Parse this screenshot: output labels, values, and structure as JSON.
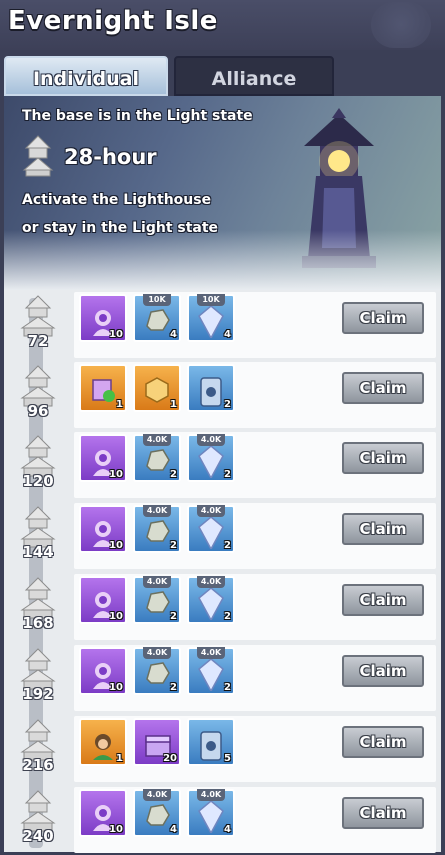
{
  "header": {
    "title": "Evernight Isle"
  },
  "tabs": [
    {
      "label": "Individual",
      "active": true
    },
    {
      "label": "Alliance",
      "active": false
    }
  ],
  "banner": {
    "state_text": "The base is in the Light state",
    "hours": "28-hour",
    "hint_line1": "Activate the Lighthouse",
    "hint_line2": "or stay in the Light state"
  },
  "rewards": [
    {
      "tier": "72",
      "claim_label": "Claim",
      "items": [
        {
          "icon": "hero-shard-icon",
          "color": "purple",
          "tag": "",
          "qty": "10"
        },
        {
          "icon": "stone-icon",
          "color": "blue",
          "tag": "10K",
          "qty": "4"
        },
        {
          "icon": "crystal-icon",
          "color": "blue",
          "tag": "10K",
          "qty": "4"
        }
      ]
    },
    {
      "tier": "96",
      "claim_label": "Claim",
      "items": [
        {
          "icon": "book-icon",
          "color": "orange",
          "tag": "",
          "qty": "1"
        },
        {
          "icon": "badge-icon",
          "color": "orange",
          "tag": "",
          "qty": "1"
        },
        {
          "icon": "card-icon",
          "color": "blue",
          "tag": "",
          "qty": "2"
        }
      ]
    },
    {
      "tier": "120",
      "claim_label": "Claim",
      "items": [
        {
          "icon": "hero-shard-icon",
          "color": "purple",
          "tag": "",
          "qty": "10"
        },
        {
          "icon": "stone-icon",
          "color": "blue",
          "tag": "4.0K",
          "qty": "2"
        },
        {
          "icon": "crystal-icon",
          "color": "blue",
          "tag": "4.0K",
          "qty": "2"
        }
      ]
    },
    {
      "tier": "144",
      "claim_label": "Claim",
      "items": [
        {
          "icon": "hero-shard-icon",
          "color": "purple",
          "tag": "",
          "qty": "10"
        },
        {
          "icon": "stone-icon",
          "color": "blue",
          "tag": "4.0K",
          "qty": "2"
        },
        {
          "icon": "crystal-icon",
          "color": "blue",
          "tag": "4.0K",
          "qty": "2"
        }
      ]
    },
    {
      "tier": "168",
      "claim_label": "Claim",
      "items": [
        {
          "icon": "hero-shard-icon",
          "color": "purple",
          "tag": "",
          "qty": "10"
        },
        {
          "icon": "stone-icon",
          "color": "blue",
          "tag": "4.0K",
          "qty": "2"
        },
        {
          "icon": "crystal-icon",
          "color": "blue",
          "tag": "4.0K",
          "qty": "2"
        }
      ]
    },
    {
      "tier": "192",
      "claim_label": "Claim",
      "items": [
        {
          "icon": "hero-shard-icon",
          "color": "purple",
          "tag": "",
          "qty": "10"
        },
        {
          "icon": "stone-icon",
          "color": "blue",
          "tag": "4.0K",
          "qty": "2"
        },
        {
          "icon": "crystal-icon",
          "color": "blue",
          "tag": "4.0K",
          "qty": "2"
        }
      ]
    },
    {
      "tier": "216",
      "claim_label": "Claim",
      "items": [
        {
          "icon": "hero-portrait-icon",
          "color": "orange",
          "tag": "",
          "qty": "1"
        },
        {
          "icon": "gift-chest-icon",
          "color": "purple",
          "tag": "",
          "qty": "20"
        },
        {
          "icon": "card-icon",
          "color": "blue",
          "tag": "",
          "qty": "5"
        }
      ]
    },
    {
      "tier": "240",
      "claim_label": "Claim",
      "items": [
        {
          "icon": "hero-shard-icon",
          "color": "purple",
          "tag": "",
          "qty": "10"
        },
        {
          "icon": "stone-icon",
          "color": "blue",
          "tag": "4.0K",
          "qty": "4"
        },
        {
          "icon": "crystal-icon",
          "color": "blue",
          "tag": "4.0K",
          "qty": "4"
        }
      ]
    }
  ]
}
